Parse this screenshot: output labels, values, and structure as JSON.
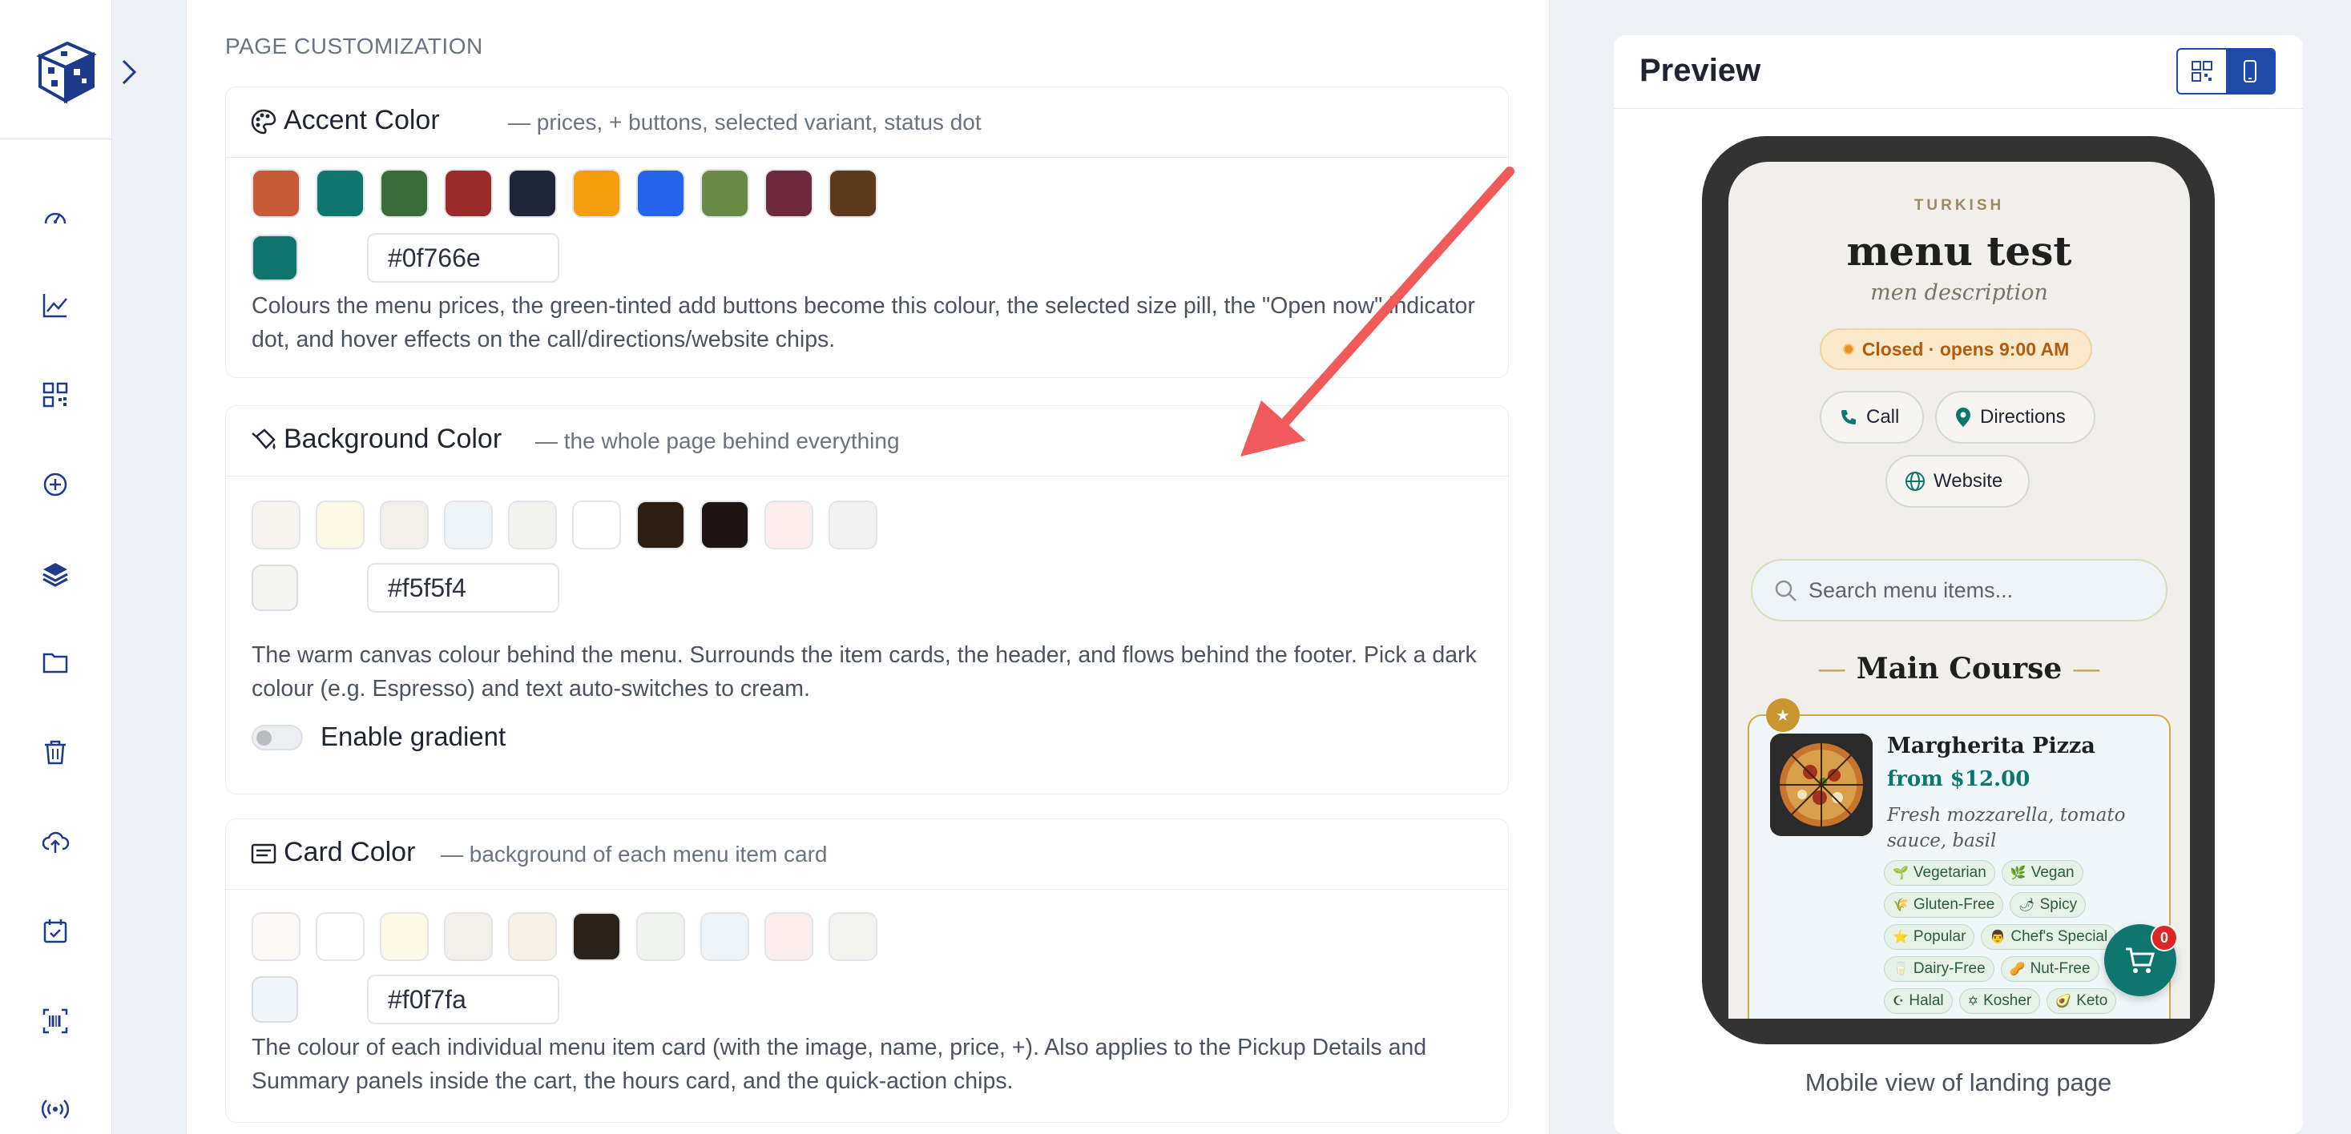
{
  "sidebar": {
    "icons": [
      "dashboard-icon",
      "analytics-icon",
      "qr-code-icon",
      "add-circle-icon",
      "layers-icon",
      "folder-icon",
      "trash-icon",
      "cloud-upload-icon",
      "calendar-check-icon",
      "barcode-icon",
      "broadcast-icon"
    ]
  },
  "settings": {
    "section_header": "PAGE CUSTOMIZATION",
    "accent": {
      "title": "Accent Color",
      "subtitle": "— prices, + buttons, selected variant, status dot",
      "swatches": [
        "#c75a38",
        "#0f766e",
        "#3a6b3a",
        "#9b2a2a",
        "#1e2638",
        "#f59e0b",
        "#2563eb",
        "#6b8a4a",
        "#6d2a3c",
        "#5e3a1c"
      ],
      "selected": "#0f766e",
      "hex_value": "#0f766e",
      "description": "Colours the menu prices, the green-tinted add buttons become this colour, the selected size pill, the \"Open now\" indicator dot, and hover effects on the call/directions/website chips."
    },
    "background": {
      "title": "Background Color",
      "subtitle": "— the whole page behind everything",
      "swatches": [
        "#f7f4ef",
        "#fcf9e9",
        "#f3efe9",
        "#eff4f8",
        "#f2f3ef",
        "#ffffff",
        "#2c1e12",
        "#1e1414",
        "#fdeeee",
        "#f2f2f2"
      ],
      "selected": "#f5f5f4",
      "hex_value": "#f5f5f4",
      "description": "The warm canvas colour behind the menu. Surrounds the item cards, the header, and flows behind the footer. Pick a dark colour (e.g. Espresso) and text auto-switches to cream.",
      "gradient_label": "Enable gradient",
      "gradient_enabled": false
    },
    "card": {
      "title": "Card Color",
      "subtitle": "— background of each menu item card",
      "swatches": [
        "#fbfaf8",
        "#ffffff",
        "#fcf9e9",
        "#f3efe9",
        "#f8f1e6",
        "#2c221c",
        "#f1f3ef",
        "#eff4f8",
        "#fdeeee",
        "#f3f3f2"
      ],
      "selected": "#f0f7fa",
      "hex_value": "#f0f7fa",
      "description": "The colour of each individual menu item card (with the image, name, price, +). Also applies to the Pickup Details and Summary panels inside the cart, the hours card, and the quick-action chips."
    }
  },
  "preview": {
    "title": "Preview",
    "view_modes": [
      "qr-view",
      "mobile-view"
    ],
    "active_view": "mobile-view",
    "caption": "Mobile view of landing page",
    "phone": {
      "cuisine": "TURKISH",
      "menu_title": "menu test",
      "menu_description": "men description",
      "status": "Closed · opens 9:00 AM",
      "chips": {
        "call": "Call",
        "directions": "Directions",
        "website": "Website"
      },
      "search_placeholder": "Search menu items...",
      "section_title": "Main Course",
      "item": {
        "name": "Margherita Pizza",
        "price": "from $12.00",
        "description": "Fresh mozzarella, tomato sauce, basil",
        "tags": [
          {
            "icon": "🌱",
            "label": "Vegetarian"
          },
          {
            "icon": "🌿",
            "label": "Vegan"
          },
          {
            "icon": "🌾",
            "label": "Gluten-Free"
          },
          {
            "icon": "🌶",
            "label": "Spicy"
          },
          {
            "icon": "⭐",
            "label": "Popular"
          },
          {
            "icon": "👨",
            "label": "Chef's Special"
          },
          {
            "icon": "🥛",
            "label": "Dairy-Free"
          },
          {
            "icon": "🥜",
            "label": "Nut-Free"
          },
          {
            "icon": "☪",
            "label": "Halal"
          },
          {
            "icon": "✡",
            "label": "Kosher"
          },
          {
            "icon": "🥑",
            "label": "Keto"
          }
        ]
      },
      "cart_count": "0"
    }
  },
  "colors": {
    "brand": "#1f4aa8",
    "accent": "#0f766e",
    "annotation_arrow": "#f05a5a"
  }
}
